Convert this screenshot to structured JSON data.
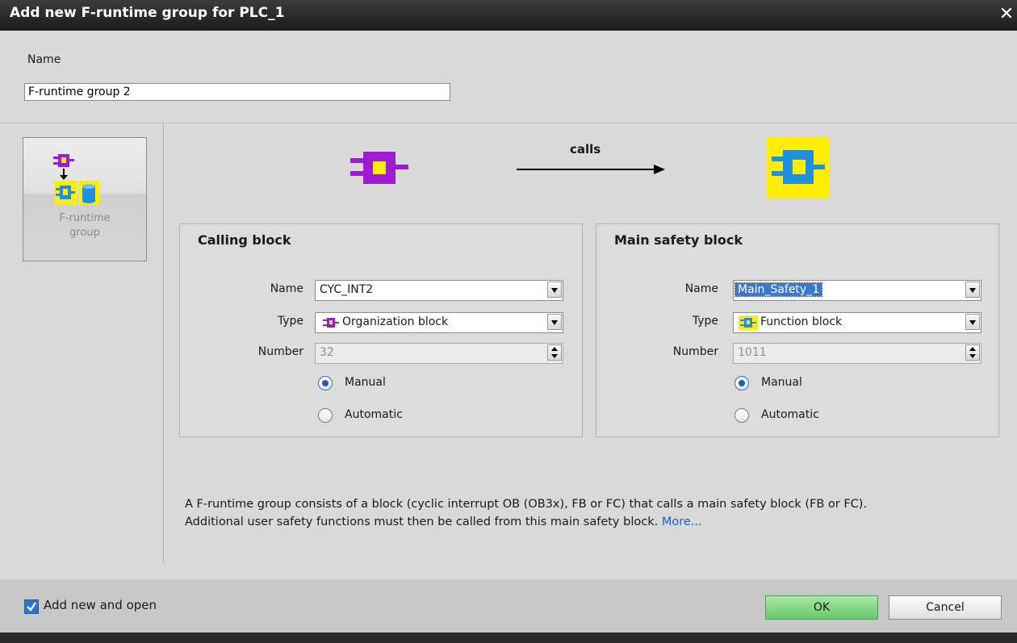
{
  "window": {
    "title": "Add new F-runtime group for PLC_1",
    "close_glyph": "✕"
  },
  "name_section": {
    "label": "Name",
    "value": "F-runtime group 2"
  },
  "tile": {
    "label_line1": "F-runtime",
    "label_line2": "group"
  },
  "diagram": {
    "calls_label": "calls"
  },
  "calling_block": {
    "title": "Calling block",
    "name_label": "Name",
    "name_value": "CYC_INT2",
    "type_label": "Type",
    "type_value": "Organization block",
    "number_label": "Number",
    "number_value": "32",
    "manual_label": "Manual",
    "automatic_label": "Automatic",
    "selected": "Manual"
  },
  "main_safety_block": {
    "title": "Main safety block",
    "name_label": "Name",
    "name_value": "Main_Safety_1",
    "type_label": "Type",
    "type_value": "Function block",
    "number_label": "Number",
    "number_value": "1011",
    "manual_label": "Manual",
    "automatic_label": "Automatic",
    "selected": "Manual"
  },
  "info": {
    "text_line1": "A F-runtime group consists of a block (cyclic interrupt OB (OB3x), FB or FC) that calls a main safety block (FB or FC).",
    "text_line2": "Additional user safety functions must then be called from this main safety block.",
    "more_link": "More..."
  },
  "footer": {
    "checkbox_label": "Add new and open",
    "checkbox_checked": true,
    "ok_label": "OK",
    "cancel_label": "Cancel"
  },
  "colors": {
    "ob_purple": "#9d1bd1",
    "fb_blue": "#1f8fe0",
    "highlight_yellow": "#ffee00",
    "ok_green": "#7fd87f",
    "selection_blue": "#3a78d4"
  },
  "icons": [
    "organization-block-icon",
    "function-block-icon",
    "data-block-icon",
    "arrow-icon"
  ]
}
